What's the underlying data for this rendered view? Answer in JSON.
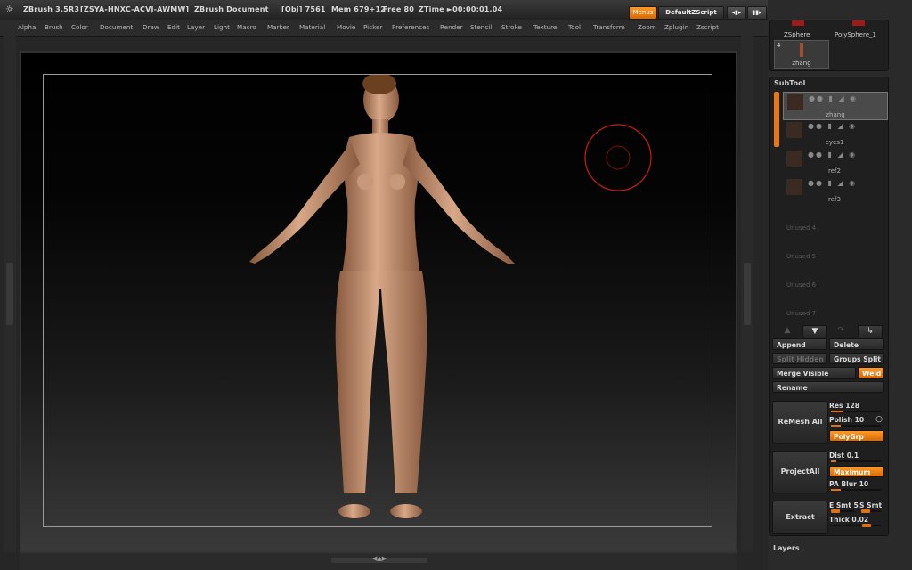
{
  "titlebar": {
    "app": "ZBrush 3.5R3",
    "serial": "[ZSYA-HNXC-ACVJ-AWMW]",
    "document": "ZBrush Document",
    "obj": "[Obj] 7561",
    "mem": "Mem 679+12",
    "free": "Free 80",
    "ztime": "ZTime ►00:00:01.04",
    "menus_label": "Menus",
    "script_label": "DefaultZScript"
  },
  "menubar": [
    "Alpha",
    "Brush",
    "Color",
    "Document",
    "Draw",
    "Edit",
    "Layer",
    "Light",
    "Macro",
    "Marker",
    "Material",
    "Movie",
    "Picker",
    "Preferences",
    "Render",
    "Stencil",
    "Stroke",
    "Texture",
    "Tool",
    "Transform",
    "Zoom",
    "Zplugin",
    "Zscript"
  ],
  "tool_strip": {
    "items": [
      {
        "label": "ZSphere"
      },
      {
        "label": "PolySphere_1"
      }
    ],
    "current_count": "4",
    "current_name": "zhang"
  },
  "subtool": {
    "header": "SubTool",
    "rows": [
      {
        "name": "zhang",
        "selected": true
      },
      {
        "name": "eyes1"
      },
      {
        "name": "ref2"
      },
      {
        "name": "ref3"
      },
      {
        "name": "Unused 4",
        "unused": true
      },
      {
        "name": "Unused 5",
        "unused": true
      },
      {
        "name": "Unused 6",
        "unused": true
      },
      {
        "name": "Unused 7",
        "unused": true
      }
    ]
  },
  "buttons": {
    "append": "Append",
    "delete": "Delete",
    "split_hidden": "Split Hidden",
    "groups_split": "Groups Split",
    "merge_visible": "Merge Visible",
    "weld": "Weld",
    "rename": "Rename",
    "remesh_all": "ReMesh All",
    "project_all": "ProjectAll",
    "extract": "Extract",
    "polygrp": "PolyGrp",
    "maximum": "Maximum"
  },
  "sliders": {
    "res": {
      "label": "Res",
      "value": "128",
      "level": 0.25
    },
    "polish": {
      "label": "Polish",
      "value": "10",
      "level": 0.2
    },
    "dist": {
      "label": "Dist",
      "value": "0.1",
      "level": 0.1
    },
    "pa_blur": {
      "label": "PA Blur",
      "value": "10",
      "level": 0.2
    },
    "e_smt": {
      "label": "E Smt",
      "value": "5"
    },
    "s_smt": {
      "label": "S Smt",
      "value": ""
    },
    "thick": {
      "label": "Thick",
      "value": "0.02",
      "level": 0.8
    }
  },
  "layers_label": "Layers",
  "colors": {
    "accent": "#e8780f",
    "ring": "#cc1a1a"
  }
}
